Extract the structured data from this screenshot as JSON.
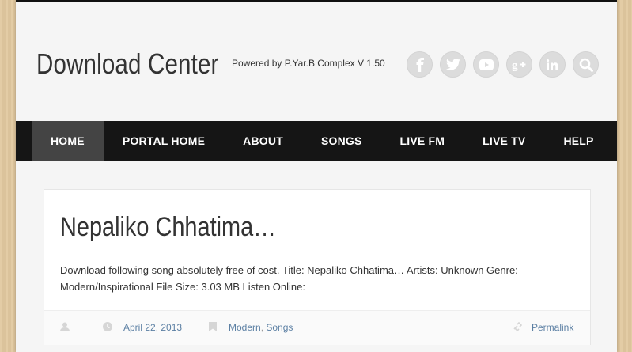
{
  "header": {
    "site_title": "Download Center",
    "tagline": "Powered by P.Yar.B Complex V 1.50",
    "social_icons": [
      "facebook-icon",
      "twitter-icon",
      "youtube-icon",
      "google-plus-icon",
      "linkedin-icon",
      "search-icon"
    ]
  },
  "nav": {
    "items": [
      {
        "label": "HOME"
      },
      {
        "label": "PORTAL HOME"
      },
      {
        "label": "ABOUT"
      },
      {
        "label": "SONGS"
      },
      {
        "label": "LIVE FM"
      },
      {
        "label": "LIVE TV"
      },
      {
        "label": "HELP"
      }
    ],
    "active": "HOME"
  },
  "post": {
    "title": "Nepaliko Chhatima…",
    "excerpt": "Download following song absolutely free of cost. Title: Nepaliko Chhatima… Artists: Unknown Genre: Modern/Inspirational File Size: 3.03 MB Listen Online:",
    "date": "April 22, 2013",
    "categories": [
      "Modern",
      "Songs"
    ],
    "category_separator": ",",
    "permalink_label": "Permalink"
  },
  "colors": {
    "nav_bg": "#151515",
    "nav_active": "#444444",
    "link": "#5b7fa3",
    "social_circle": "#dcdcdc"
  }
}
